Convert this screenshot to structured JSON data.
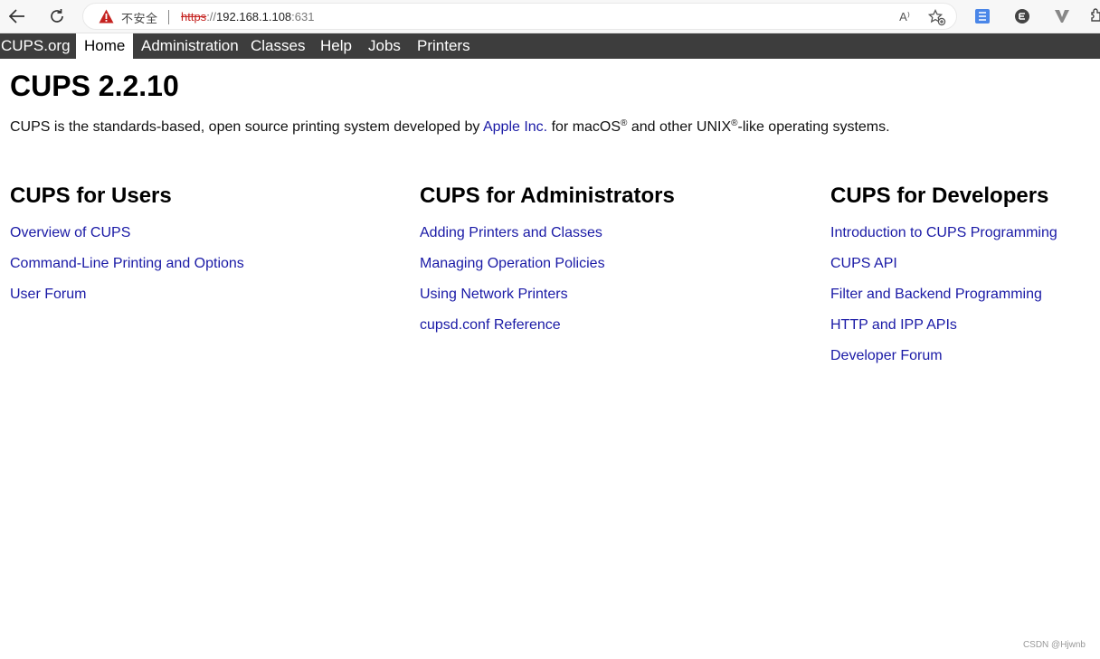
{
  "browser": {
    "security_label": "不安全",
    "url_scheme": "https",
    "url_sep": "://",
    "url_host": "192.168.1.108",
    "url_port": ":631",
    "read_aloud_label": "A⁾"
  },
  "nav": {
    "items": [
      {
        "label": "CUPS.org"
      },
      {
        "label": "Home",
        "active": true
      },
      {
        "label": "Administration"
      },
      {
        "label": "Classes"
      },
      {
        "label": "Help"
      },
      {
        "label": "Jobs"
      },
      {
        "label": "Printers"
      }
    ]
  },
  "page": {
    "title": "CUPS 2.2.10",
    "intro_before": "CUPS is the standards-based, open source printing system developed by ",
    "intro_link": "Apple Inc.",
    "intro_middle": " for macOS",
    "reg_mark": "®",
    "intro_middle2": " and other UNIX",
    "reg_mark2": "®",
    "intro_after": "-like operating systems."
  },
  "sections": [
    {
      "title": "CUPS for Users",
      "links": [
        "Overview of CUPS",
        "Command-Line Printing and Options",
        "User Forum"
      ]
    },
    {
      "title": "CUPS for Administrators",
      "links": [
        "Adding Printers and Classes",
        "Managing Operation Policies",
        "Using Network Printers",
        "cupsd.conf Reference"
      ]
    },
    {
      "title": "CUPS for Developers",
      "links": [
        "Introduction to CUPS Programming",
        "CUPS API",
        "Filter and Backend Programming",
        "HTTP and IPP APIs",
        "Developer Forum"
      ]
    }
  ],
  "watermark": "CSDN @Hjwnb",
  "colors": {
    "link": "#1a1aa6",
    "nav_bg": "#3d3d3d",
    "warning": "#c5221f"
  }
}
